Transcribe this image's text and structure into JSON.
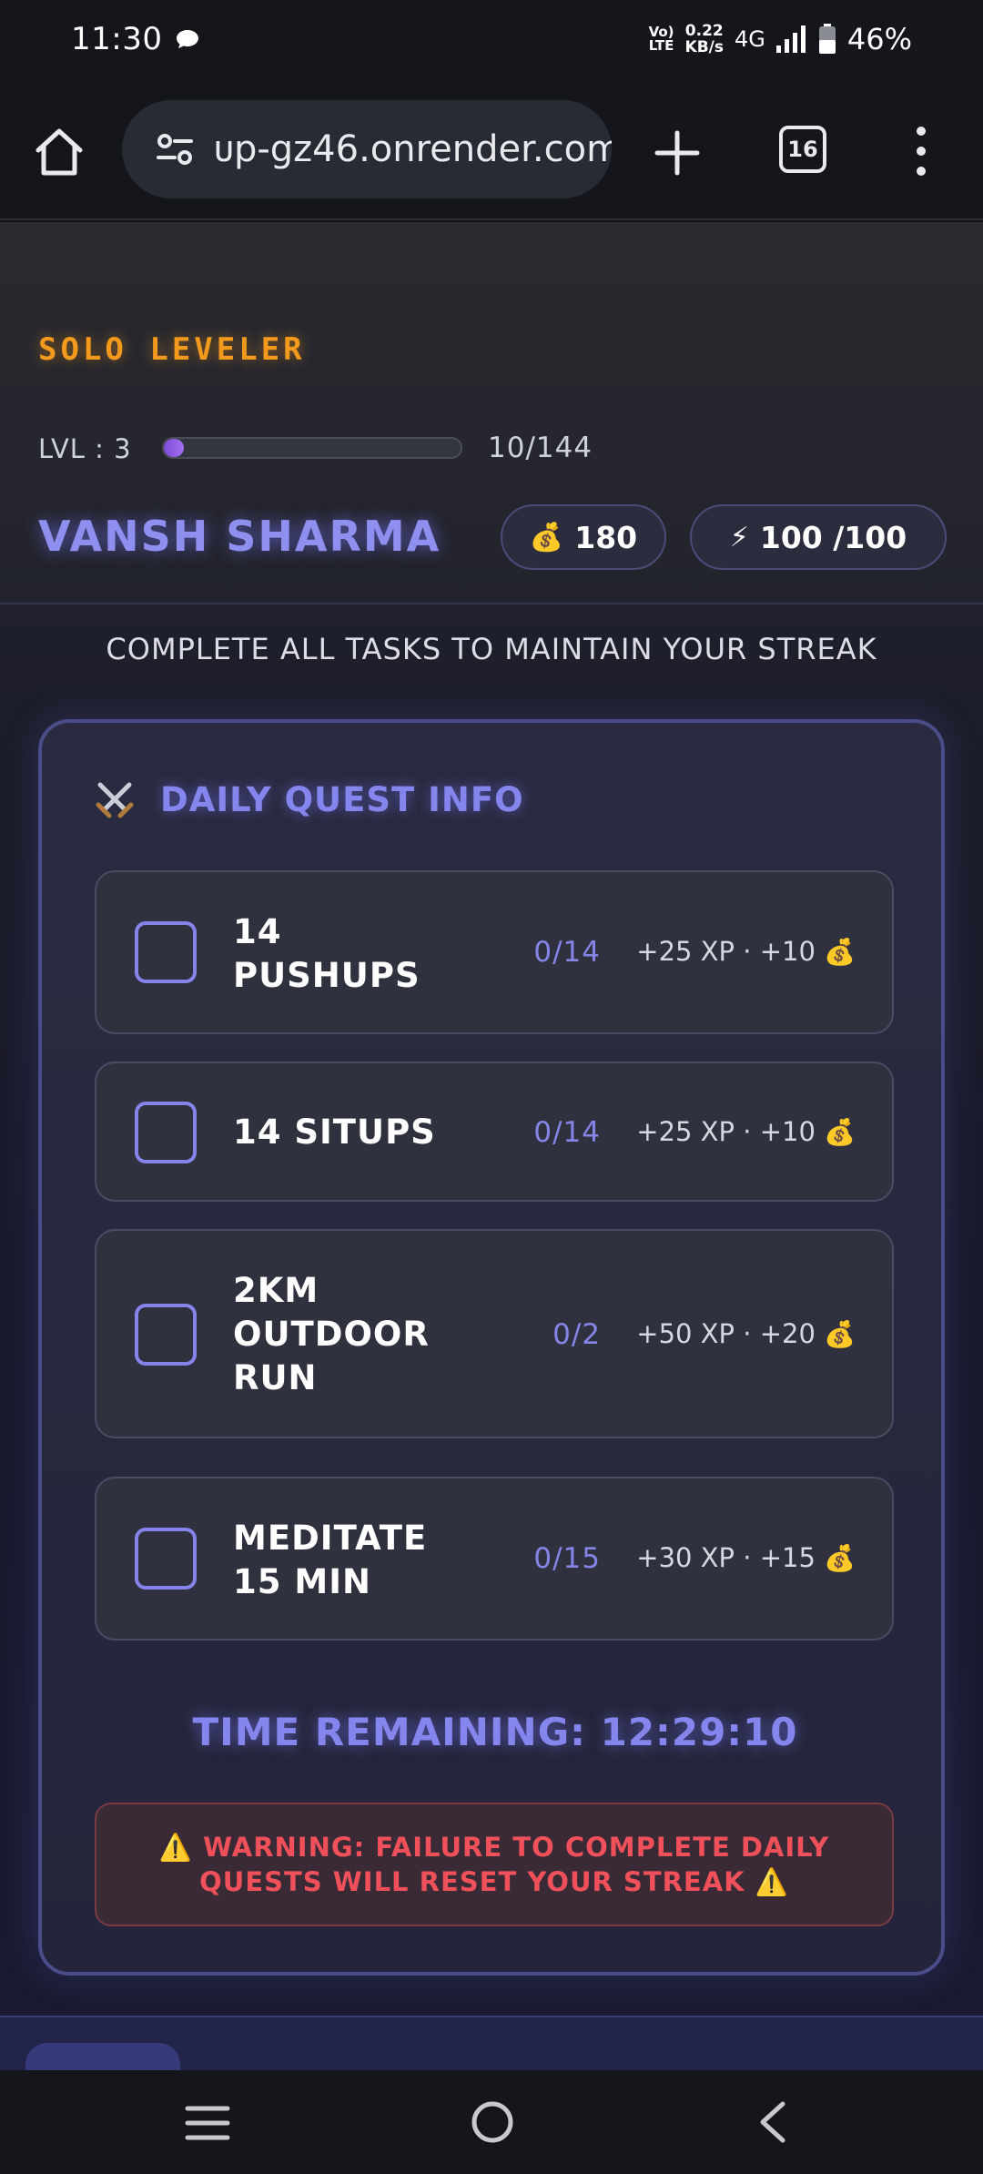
{
  "status_bar": {
    "time": "11:30",
    "network_lte": "Vo)\nLTE",
    "speed_value": "0.22",
    "speed_unit": "KB/s",
    "network_type": "4G",
    "battery": "46%"
  },
  "browser": {
    "url": "ᴜp-gz46.onrender.com",
    "tab_count": "16"
  },
  "header": {
    "brand": "SOLO LEVELER",
    "level_label": "LVL : 3",
    "xp_text": "10/144",
    "xp_progress": 0.069,
    "player_name": "VANSH SHARMA",
    "gold_icon": "💰",
    "gold": "180",
    "energy_icon": "⚡",
    "energy": "100 /100"
  },
  "streak_note": "COMPLETE ALL TASKS TO MAINTAIN YOUR STREAK",
  "quest_panel": {
    "icon": "crossed-swords-icon",
    "title": "DAILY QUEST INFO",
    "quests": [
      {
        "name": "14 PUSHUPS",
        "progress": "0/14",
        "reward": "+25 XP · +10",
        "reward_icon": "💰"
      },
      {
        "name": "14 SITUPS",
        "progress": "0/14",
        "reward": "+25 XP · +10",
        "reward_icon": "💰"
      },
      {
        "name": "2KM OUTDOOR RUN",
        "progress": "0/2",
        "reward": "+50 XP · +20",
        "reward_icon": "💰"
      },
      {
        "name": "MEDITATE 15 MIN",
        "progress": "0/15",
        "reward": "+30 XP · +15",
        "reward_icon": "💰"
      }
    ],
    "timer": "TIME REMAINING: 12:29:10",
    "warning": "⚠️ WARNING: FAILURE TO COMPLETE DAILY QUESTS WILL RESET YOUR STREAK ⚠️"
  },
  "colors": {
    "accent": "#8585ee",
    "brand": "#f39a1c",
    "warning": "#f0505a",
    "xp_fill": "#8f5ae6"
  }
}
